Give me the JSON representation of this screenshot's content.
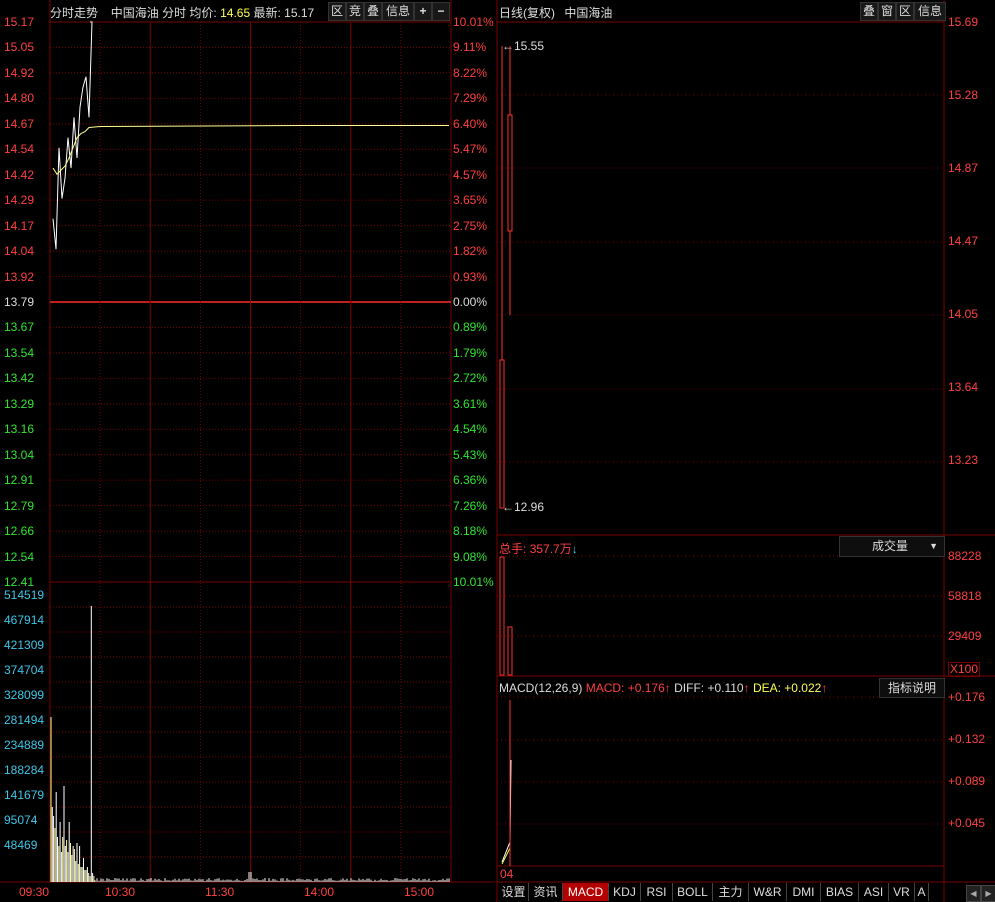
{
  "left_header": {
    "title": "分时走势",
    "stock": "中国海油",
    "mode": "分时",
    "avg_label": "均价:",
    "avg_value": "14.65",
    "latest_label": "最新:",
    "latest_value": "15.17"
  },
  "left_buttons": [
    "区",
    "竞",
    "叠",
    "信息"
  ],
  "price_axis": [
    "15.17",
    "15.05",
    "14.92",
    "14.80",
    "14.67",
    "14.54",
    "14.42",
    "14.29",
    "14.17",
    "14.04",
    "13.92",
    "13.79",
    "13.67",
    "13.54",
    "13.42",
    "13.29",
    "13.16",
    "13.04",
    "12.91",
    "12.79",
    "12.66",
    "12.54",
    "12.41"
  ],
  "pct_axis": [
    "10.01%",
    "9.11%",
    "8.22%",
    "7.29%",
    "6.40%",
    "5.47%",
    "4.57%",
    "3.65%",
    "2.75%",
    "1.82%",
    "0.93%",
    "0.00%",
    "0.89%",
    "1.79%",
    "2.72%",
    "3.61%",
    "4.54%",
    "5.43%",
    "6.36%",
    "7.26%",
    "8.18%",
    "9.08%",
    "10.01%"
  ],
  "volume_axis": [
    "514519",
    "467914",
    "421309",
    "374704",
    "328099",
    "281494",
    "234889",
    "188284",
    "141679",
    "95074",
    "48469"
  ],
  "time_axis": [
    "09:30",
    "10:30",
    "11:30",
    "14:00",
    "15:00"
  ],
  "intraday": {
    "price": [
      14.2,
      14.05,
      14.55,
      14.3,
      14.4,
      14.6,
      14.45,
      14.7,
      14.5,
      14.75,
      14.85,
      14.9,
      14.7,
      15.17
    ],
    "avg": [
      14.45,
      14.42,
      14.44,
      14.46,
      14.5,
      14.55,
      14.6,
      14.62,
      14.63,
      14.65
    ]
  },
  "right_header": {
    "title": "日线(复权)",
    "stock": "中国海油"
  },
  "right_buttons": [
    "叠",
    "窗",
    "区",
    "信息"
  ],
  "kline_axis": [
    "15.69",
    "15.28",
    "14.87",
    "14.47",
    "14.05",
    "13.64",
    "13.23"
  ],
  "kline": {
    "high_label": "15.55",
    "low_label": "12.96"
  },
  "vol_header": {
    "label": "总手:",
    "value": "357.7万",
    "arrow": "↓"
  },
  "vol_dropdown": "成交量",
  "vol_axis": [
    "88228",
    "58818",
    "29409"
  ],
  "vol_unit": "X100",
  "macd_header": {
    "name": "MACD(12,26,9)",
    "macd": "MACD: +0.176",
    "diff_label": "DIFF:",
    "diff": "+0.110",
    "dea": "DEA: +0.022",
    "up": "↑"
  },
  "macd_explain": "指标说明",
  "macd_axis": [
    "+0.176",
    "+0.132",
    "+0.089",
    "+0.045"
  ],
  "macd_date": "04",
  "tabs": [
    "设置",
    "资讯",
    "MACD",
    "KDJ",
    "RSI",
    "BOLL",
    "主力",
    "W&R",
    "DMI",
    "BIAS",
    "ASI",
    "VR",
    "A"
  ],
  "active_tab": "MACD",
  "colors": {
    "grid": "#7a0000",
    "up": "#ff3030",
    "down": "#2fe62f",
    "cyan": "#3ec6e6",
    "avg": "#ffff90"
  }
}
